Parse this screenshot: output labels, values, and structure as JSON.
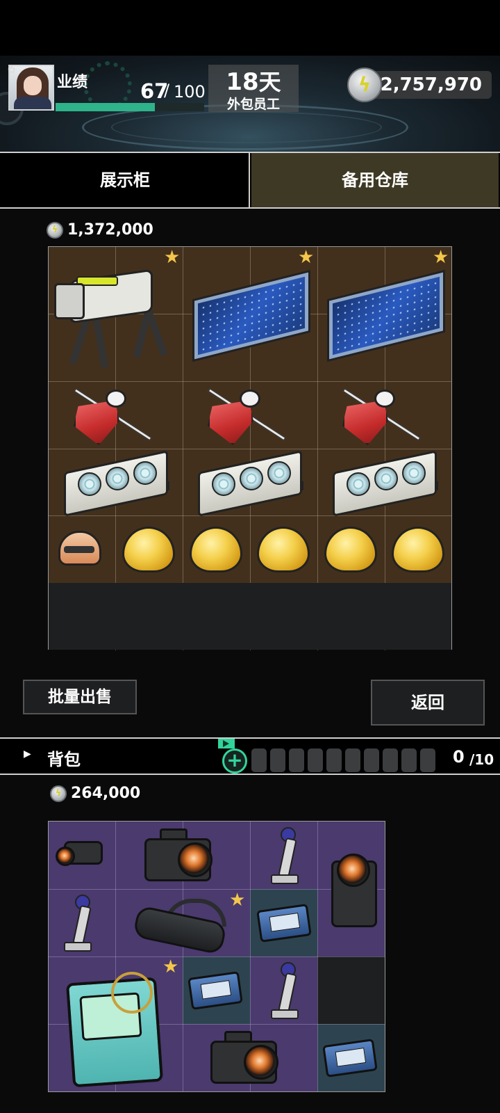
{
  "header": {
    "performance_label": "业绩",
    "performance_value": "67",
    "performance_separator": "/",
    "performance_max": "100",
    "performance_fraction": 0.67,
    "days_value": "18",
    "days_unit": "天",
    "role_label": "外包员工",
    "energy_value": "2,757,970"
  },
  "tabs": {
    "showcase": "展示柜",
    "storage": "备用仓库",
    "active": "storage"
  },
  "storage": {
    "total_value": "1,372,000",
    "items": [
      "robot-dog",
      "star-map",
      "star-map",
      "red-gem-pin",
      "red-gem-pin",
      "red-gem-pin",
      "graphics-card",
      "graphics-card",
      "graphics-card",
      "helmet-drone",
      "gold-nugget",
      "gold-nugget",
      "gold-nugget",
      "gold-nugget",
      "gold-nugget"
    ]
  },
  "actions": {
    "batch_sell": "批量出售",
    "back": "返回"
  },
  "backpack": {
    "title": "背包",
    "count": "0",
    "capacity": "/10",
    "total_value": "264,000",
    "items": [
      "camera-scope",
      "dslr-camera",
      "statue",
      "camcorder",
      "statue",
      "vr-headset",
      "hard-drive",
      "bmo-console",
      "hard-drive",
      "statue",
      "dslr-camera",
      "hard-drive"
    ]
  },
  "colors": {
    "accent_green": "#32d49a",
    "star_gold": "#f4c64a",
    "tab_active": "#3e3925",
    "storage_grid": "#42301d",
    "backpack_grid": "#4a3a6e"
  }
}
